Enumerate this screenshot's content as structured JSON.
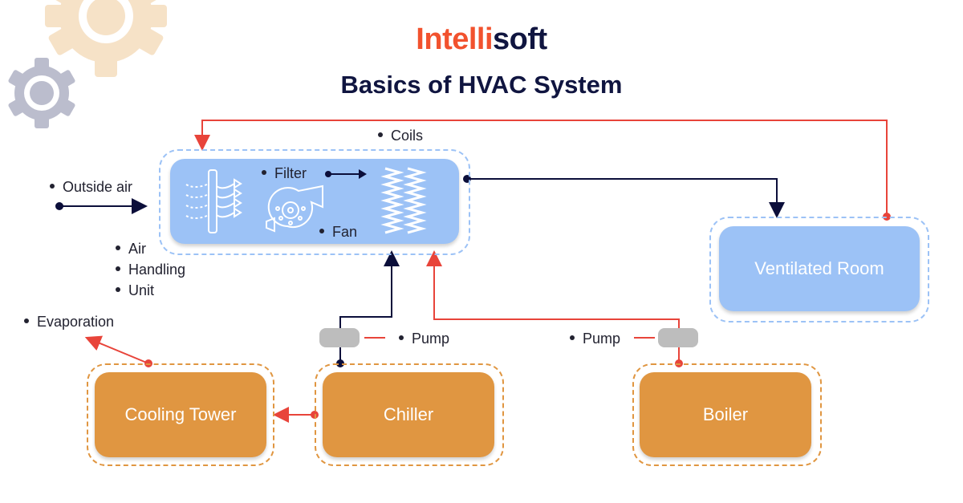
{
  "brand": {
    "part1": "Intelli",
    "part2": "soft"
  },
  "title": "Basics of HVAC System",
  "colors": {
    "blue_flow": "#0b0e3a",
    "red_flow": "#e8443a",
    "unit_blue": "#9cc2f6",
    "unit_orange": "#e09641",
    "pump_gray": "#bdbdbd"
  },
  "ahu": {
    "labels": {
      "coils": "Coils",
      "filter": "Filter",
      "fan": "Fan"
    },
    "side_label": [
      "Air",
      "Handling",
      "Unit"
    ],
    "icons": [
      "air-filter-icon",
      "blower-fan-icon",
      "coil-icon"
    ]
  },
  "inputs": {
    "outside_air": "Outside air"
  },
  "nodes": {
    "ventilated_room": "Ventilated Room",
    "cooling_tower": "Cooling Tower",
    "chiller": "Chiller",
    "boiler": "Boiler"
  },
  "pumps": [
    {
      "label": "Pump"
    },
    {
      "label": "Pump"
    }
  ],
  "evaporation": "Evaporation",
  "decor": [
    "gear-icon",
    "gear-icon"
  ]
}
